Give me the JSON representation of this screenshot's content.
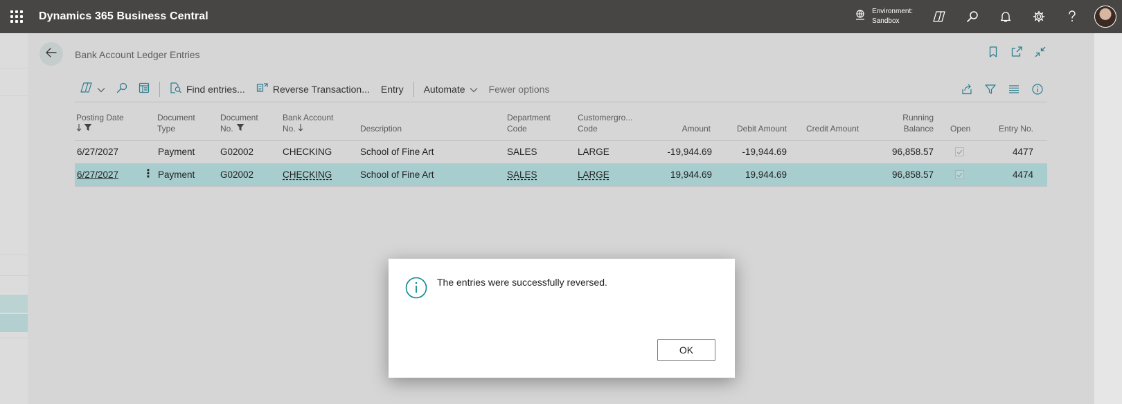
{
  "topbar": {
    "app_title": "Dynamics 365 Business Central",
    "env_label": "Environment:",
    "env_value": "Sandbox"
  },
  "page": {
    "title": "Bank Account Ledger Entries"
  },
  "actionbar": {
    "find_entries": "Find entries...",
    "reverse_transaction": "Reverse Transaction...",
    "entry": "Entry",
    "automate": "Automate",
    "fewer_options": "Fewer options"
  },
  "grid": {
    "headers": {
      "posting_date": "Posting Date",
      "document_type_1": "Document",
      "document_type_2": "Type",
      "document_no_1": "Document",
      "document_no_2": "No.",
      "bank_account_no_1": "Bank Account",
      "bank_account_no_2": "No.",
      "description": "Description",
      "department_code_1": "Department",
      "department_code_2": "Code",
      "customergroup_code_1": "Customergro...",
      "customergroup_code_2": "Code",
      "amount": "Amount",
      "debit_amount": "Debit Amount",
      "credit_amount": "Credit Amount",
      "running_balance_1": "Running",
      "running_balance_2": "Balance",
      "open": "Open",
      "entry_no": "Entry No."
    },
    "rows": [
      {
        "posting_date": "6/27/2027",
        "document_type": "Payment",
        "document_no": "G02002",
        "bank_account_no": "CHECKING",
        "description": "School of Fine Art",
        "department_code": "SALES",
        "customergroup_code": "LARGE",
        "amount": "-19,944.69",
        "debit_amount": "-19,944.69",
        "credit_amount": "",
        "running_balance": "96,858.57",
        "open": true,
        "entry_no": "4477"
      },
      {
        "posting_date": "6/27/2027",
        "document_type": "Payment",
        "document_no": "G02002",
        "bank_account_no": "CHECKING",
        "description": "School of Fine Art",
        "department_code": "SALES",
        "customergroup_code": "LARGE",
        "amount": "19,944.69",
        "debit_amount": "19,944.69",
        "credit_amount": "",
        "running_balance": "96,858.57",
        "open": true,
        "entry_no": "4474"
      }
    ]
  },
  "dialog": {
    "message": "The entries were successfully reversed.",
    "ok_label": "OK"
  },
  "colors": {
    "topbar_bg": "#484644",
    "selected_row": "#a8cdce",
    "info_icon": "#0b8a8f"
  },
  "icons": [
    "waffle-icon",
    "environment-icon",
    "copilot-icon",
    "search-icon",
    "bell-icon",
    "gear-icon",
    "help-icon",
    "back-arrow-icon",
    "bookmark-icon",
    "open-new-window-icon",
    "collapse-icon",
    "filter-icon",
    "info-icon"
  ]
}
